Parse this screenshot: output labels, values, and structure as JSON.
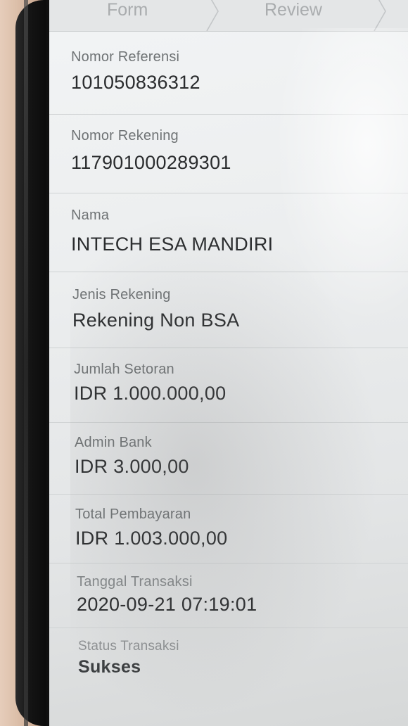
{
  "stepper": {
    "steps": [
      {
        "label": "Form"
      },
      {
        "label": "Review"
      }
    ]
  },
  "details": [
    {
      "label": "Nomor Referensi",
      "value": "101050836312"
    },
    {
      "label": "Nomor Rekening",
      "value": "117901000289301"
    },
    {
      "label": "Nama",
      "value": "INTECH ESA MANDIRI"
    },
    {
      "label": "Jenis Rekening",
      "value": "Rekening Non BSA"
    },
    {
      "label": "Jumlah Setoran",
      "value": "IDR 1.000.000,00"
    },
    {
      "label": "Admin Bank",
      "value": "IDR 3.000,00"
    },
    {
      "label": "Total Pembayaran",
      "value": "IDR 1.003.000,00"
    },
    {
      "label": "Tanggal Transaksi",
      "value": "2020-09-21 07:19:01"
    },
    {
      "label": "Status Transaksi",
      "value": "Sukses"
    }
  ],
  "icons": {
    "step_separator": "chevron-right-icon"
  },
  "colors": {
    "screen_background": "#eceeef",
    "label_text": "#6f7375",
    "value_text": "#2a2c2e",
    "divider": "#cfd2d3"
  }
}
